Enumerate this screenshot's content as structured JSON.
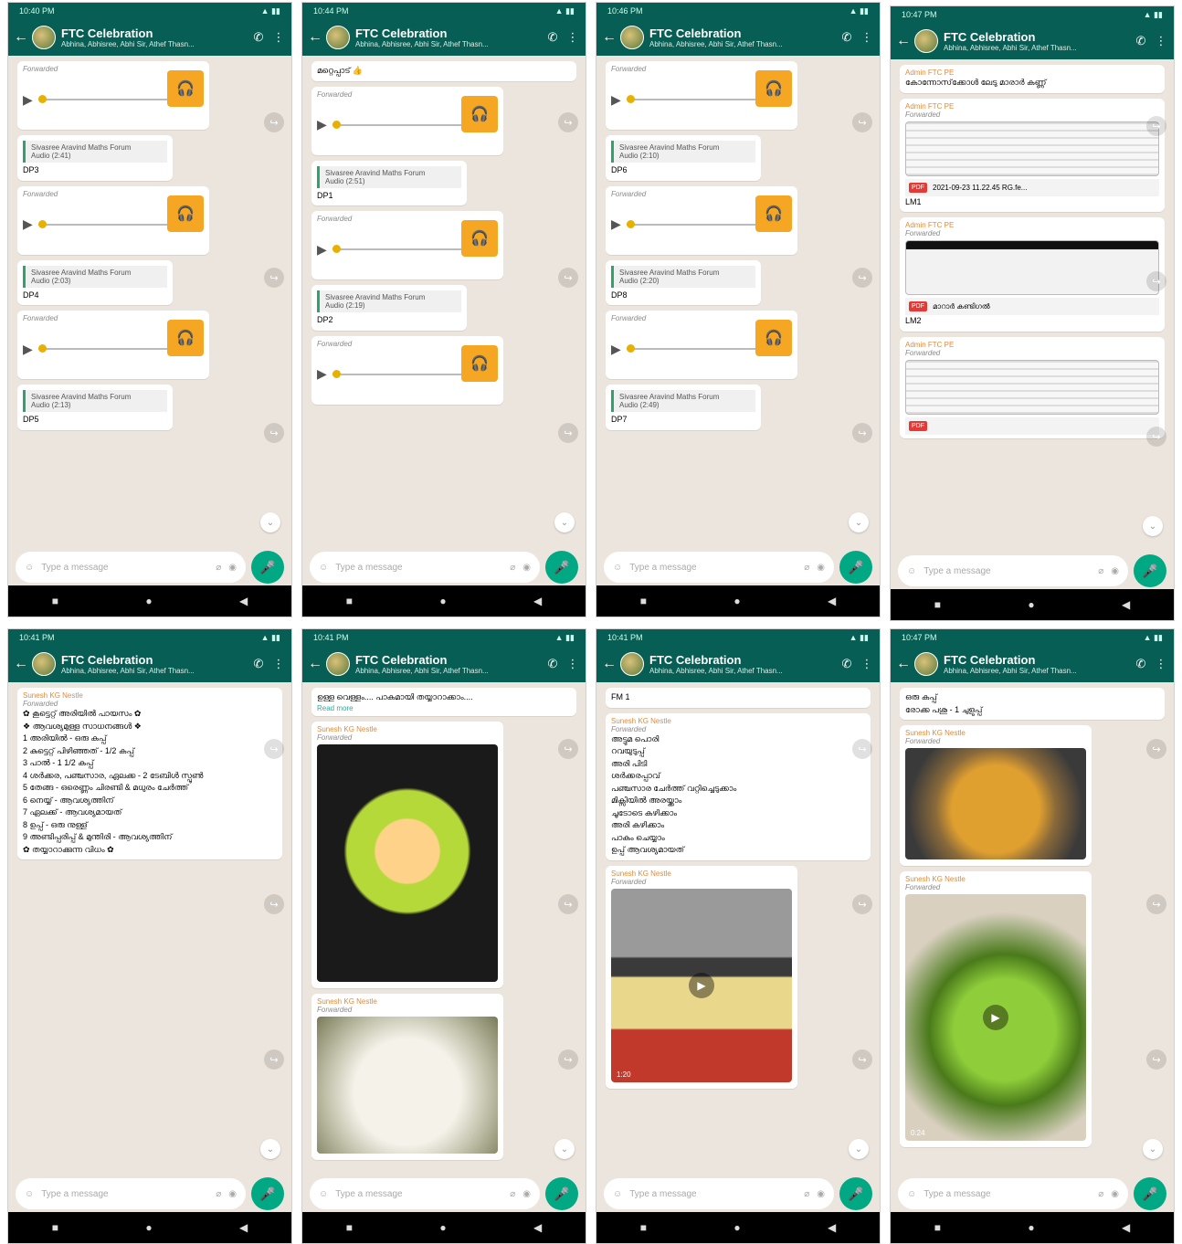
{
  "chat": {
    "title": "FTC Celebration",
    "subtitle": "Abhina, Abhisree, Abhi Sir, Athef Thasn..."
  },
  "input": {
    "placeholder": "Type a message"
  },
  "screens": [
    {
      "time": "10:40 PM",
      "bubbles": [
        {
          "type": "audio",
          "label": "Forwarded"
        },
        {
          "type": "reply",
          "quote": "Sivasree Aravind Maths Forum",
          "quote_sub": "Audio (2:41)",
          "text": "DP3"
        },
        {
          "type": "audio",
          "label": "Forwarded"
        },
        {
          "type": "reply",
          "quote": "Sivasree Aravind Maths Forum",
          "quote_sub": "Audio (2:03)",
          "text": "DP4"
        },
        {
          "type": "audio",
          "label": "Forwarded"
        },
        {
          "type": "reply",
          "quote": "Sivasree Aravind Maths Forum",
          "quote_sub": "Audio (2:13)",
          "text": "DP5"
        }
      ]
    },
    {
      "time": "10:44 PM",
      "bubbles": [
        {
          "type": "text",
          "text": "മറ്റെപ്പാട് 👍"
        },
        {
          "type": "audio",
          "label": "Forwarded"
        },
        {
          "type": "reply",
          "quote": "Sivasree Aravind Maths Forum",
          "quote_sub": "Audio (2:51)",
          "text": "DP1"
        },
        {
          "type": "audio",
          "label": "Forwarded"
        },
        {
          "type": "reply",
          "quote": "Sivasree Aravind Maths Forum",
          "quote_sub": "Audio (2:19)",
          "text": "DP2"
        },
        {
          "type": "audio",
          "label": "Forwarded"
        }
      ]
    },
    {
      "time": "10:46 PM",
      "bubbles": [
        {
          "type": "audio",
          "label": "Forwarded"
        },
        {
          "type": "reply",
          "quote": "Sivasree Aravind Maths Forum",
          "quote_sub": "Audio (2:10)",
          "text": "DP6"
        },
        {
          "type": "audio",
          "label": "Forwarded"
        },
        {
          "type": "reply",
          "quote": "Sivasree Aravind Maths Forum",
          "quote_sub": "Audio (2:20)",
          "text": "DP8"
        },
        {
          "type": "audio",
          "label": "Forwarded"
        },
        {
          "type": "reply",
          "quote": "Sivasree Aravind Maths Forum",
          "quote_sub": "Audio (2:49)",
          "text": "DP7"
        }
      ]
    },
    {
      "time": "10:47 PM",
      "bubbles": [
        {
          "type": "text",
          "sender": "Admin FTC PE",
          "text": "കോന്നോസ്‌ക്കോൾ ലേടു മാരാർ കണ്ണ്"
        },
        {
          "type": "doc",
          "sender": "Admin FTC PE",
          "label": "Forwarded",
          "file": "2021-09-23 11.22.45 RG.fe...",
          "caption": "LM1"
        },
        {
          "type": "doc2",
          "sender": "Admin FTC PE",
          "label": "Forwarded",
          "file": "മാറാർ കണ്ടിഗൽ",
          "caption": "LM2"
        },
        {
          "type": "doc",
          "sender": "Admin FTC PE",
          "label": "Forwarded",
          "file": "",
          "caption": ""
        }
      ]
    },
    {
      "time": "10:41 PM",
      "bubbles": [
        {
          "type": "recipe",
          "sender": "Sunesh KG Nestle",
          "label": "Forwarded",
          "text": "✿ കൂട്ടെറ്റ് അരിയിൽ പായസം ✿\n❖ ആവശ്യമുള്ള സാധനങ്ങൾ ❖\n1 അരിയിൽ - ഒരു കപ്പ്\n2 കുട്ടെറ്റ് പിഴിഞ്ഞത് - 1/2 കപ്പ്\n3 പാൽ - 1 1/2 കപ്പ്\n4 ശർക്കര, പഞ്ചസാര, ഏലക്ക - 2 ടേബിൾ സ്പൂൺ\n5 തേങ്ങ - ഒരെണ്ണം ചിരണ്ടി & മധുരം ചേർത്ത്\n6 നെയ്യ് - ആവശ്യത്തിന്\n7 ഏലക്ക് - ആവശ്യമായത്\n8 ഉപ്പ് - ഒരു നുള്ള്\n9 അണ്ടിപ്പരിപ്പ് & മുന്തിരി - ആവശ്യത്തിന്\n✿ തയ്യാറാക്കുന്ന വിധം ✿"
        }
      ]
    },
    {
      "time": "10:41 PM",
      "bubbles": [
        {
          "type": "textmore",
          "text": "ഉള്ള വെള്ളം.... പാകമായി തയ്യാറാക്കാം....",
          "more": "Read more"
        },
        {
          "type": "image",
          "sender": "Sunesh KG Nestle",
          "label": "Forwarded",
          "img": "img-food1",
          "caption": ""
        },
        {
          "type": "image",
          "sender": "Sunesh KG Nestle",
          "label": "Forwarded",
          "img": "img-rice",
          "caption": ""
        }
      ]
    },
    {
      "time": "10:41 PM",
      "bubbles": [
        {
          "type": "text",
          "text": "FM 1"
        },
        {
          "type": "recipe",
          "sender": "Sunesh KG Nestle",
          "label": "Forwarded",
          "text": "അട്ടുമ പൊരി\nറവയുടുപ്പ്\nഅരി പിടി\nശർക്കരപ്പാവ്\nപഞ്ചസാര ചേർത്ത് വറ്റിച്ചെടുക്കാം\nമിക്സിയിൽ അരയ്ക്കാം\nചൂടോടെ കഴിക്കാം\nഅരി കഴിക്കാം\nപാകം ചെയ്യാം\nഉപ്പ് ആവശ്യമായത്"
        },
        {
          "type": "video",
          "sender": "Sunesh KG Nestle",
          "label": "Forwarded",
          "img": "img-pot",
          "duration": "1:20"
        }
      ]
    },
    {
      "time": "10:47 PM",
      "bubbles": [
        {
          "type": "text",
          "text": "ഒരു കപ്പ്\nരോക്ക പശു - 1 ചുളുപ്പ്"
        },
        {
          "type": "image",
          "sender": "Sunesh KG Nestle",
          "label": "Forwarded",
          "img": "img-pan",
          "caption": ""
        },
        {
          "type": "video",
          "sender": "Sunesh KG Nestle",
          "label": "Forwarded",
          "img": "img-gourd",
          "duration": "0:24"
        }
      ]
    }
  ],
  "icons": {
    "back": "←",
    "call": "✆",
    "menu": "⋮",
    "play": "▶",
    "headphones": "🎧",
    "share": "↪",
    "emoji": "☺",
    "attach": "⌀",
    "camera": "◉",
    "mic": "🎤",
    "nav_back": "◀",
    "nav_home": "●",
    "nav_recent": "■",
    "scroll_down": "⌄"
  },
  "colors": {
    "header": "#075e54",
    "accent": "#00a884",
    "audio_thumb": "#f5a623",
    "chat_bg": "#ece5dd"
  }
}
